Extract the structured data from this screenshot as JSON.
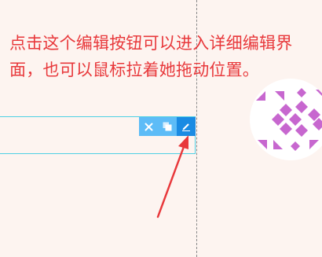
{
  "instruction": {
    "text": "点击这个编辑按钮可以进入详细编辑界面，也可以鼠标拉着她拖动位置。",
    "color": "#e8383b"
  },
  "block_toolbar": {
    "buttons": [
      {
        "icon": "close-icon",
        "action": "delete"
      },
      {
        "icon": "copy-icon",
        "action": "copy"
      },
      {
        "icon": "pencil-icon",
        "action": "edit",
        "highlighted": true
      }
    ],
    "color": "#5dbcf7",
    "active_color": "#1a8be3"
  },
  "block": {
    "border_color": "#4fd0e4"
  },
  "annotation_arrow": {
    "color": "#e8383b",
    "points_to": "edit-button"
  },
  "avatar": {
    "pattern_color": "#c767cf",
    "background": "#ffffff"
  }
}
